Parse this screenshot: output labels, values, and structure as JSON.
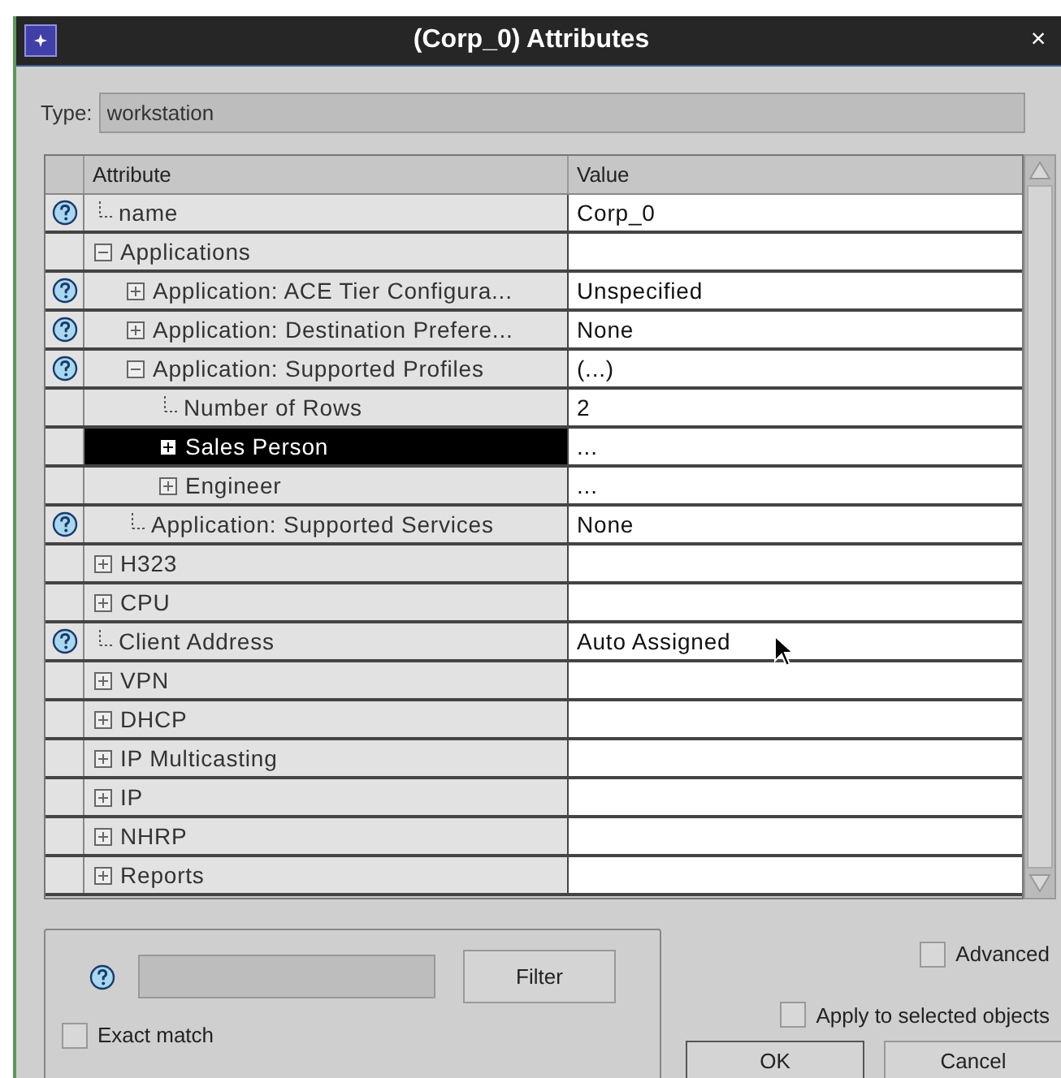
{
  "window": {
    "title": "(Corp_0) Attributes",
    "close": "×"
  },
  "type_field": {
    "label": "Type:",
    "value": "workstation"
  },
  "table": {
    "columns": [
      "Attribute",
      "Value"
    ],
    "rows": [
      {
        "kind": "leaf",
        "name": "name",
        "value": "Corp_0",
        "help": true,
        "selected": false
      },
      {
        "kind": "group",
        "name": "Applications",
        "value": "",
        "help": false,
        "selected": false,
        "expanded": true,
        "children": [
          {
            "kind": "group",
            "name": "Application: ACE Tier Configura...",
            "value": "Unspecified",
            "help": true,
            "selected": false,
            "expanded": false
          },
          {
            "kind": "group",
            "name": "Application: Destination Prefere...",
            "value": "None",
            "help": true,
            "selected": false,
            "expanded": false
          },
          {
            "kind": "group",
            "name": "Application: Supported Profiles",
            "value": "(...)",
            "help": true,
            "selected": false,
            "expanded": true,
            "children": [
              {
                "kind": "leaf",
                "name": "Number of Rows",
                "value": "2",
                "help": false,
                "selected": false
              },
              {
                "kind": "group",
                "name": "Sales Person",
                "value": "...",
                "help": false,
                "selected": true,
                "expanded": false
              },
              {
                "kind": "group",
                "name": "Engineer",
                "value": "...",
                "help": false,
                "selected": false,
                "expanded": false
              }
            ]
          },
          {
            "kind": "leaf",
            "name": "Application: Supported Services",
            "value": "None",
            "help": true,
            "selected": false
          }
        ]
      },
      {
        "kind": "group",
        "name": "H323",
        "value": "",
        "help": false,
        "selected": false,
        "expanded": false
      },
      {
        "kind": "group",
        "name": "CPU",
        "value": "",
        "help": false,
        "selected": false,
        "expanded": false
      },
      {
        "kind": "leaf",
        "name": "Client Address",
        "value": "Auto Assigned",
        "help": true,
        "selected": false
      },
      {
        "kind": "group",
        "name": "VPN",
        "value": "",
        "help": false,
        "selected": false,
        "expanded": false
      },
      {
        "kind": "group",
        "name": "DHCP",
        "value": "",
        "help": false,
        "selected": false,
        "expanded": false
      },
      {
        "kind": "group",
        "name": "IP Multicasting",
        "value": "",
        "help": false,
        "selected": false,
        "expanded": false
      },
      {
        "kind": "group",
        "name": "IP",
        "value": "",
        "help": false,
        "selected": false,
        "expanded": false
      },
      {
        "kind": "group",
        "name": "NHRP",
        "value": "",
        "help": false,
        "selected": false,
        "expanded": false
      },
      {
        "kind": "group",
        "name": "Reports",
        "value": "",
        "help": false,
        "selected": false,
        "expanded": false
      }
    ]
  },
  "filter": {
    "button": "Filter",
    "exact_match": {
      "label": "Exact match",
      "checked": false
    }
  },
  "advanced": {
    "label": "Advanced",
    "checked": false
  },
  "apply_selected": {
    "label": "Apply to selected objects",
    "checked": false
  },
  "buttons": [
    "OK",
    "Cancel"
  ]
}
